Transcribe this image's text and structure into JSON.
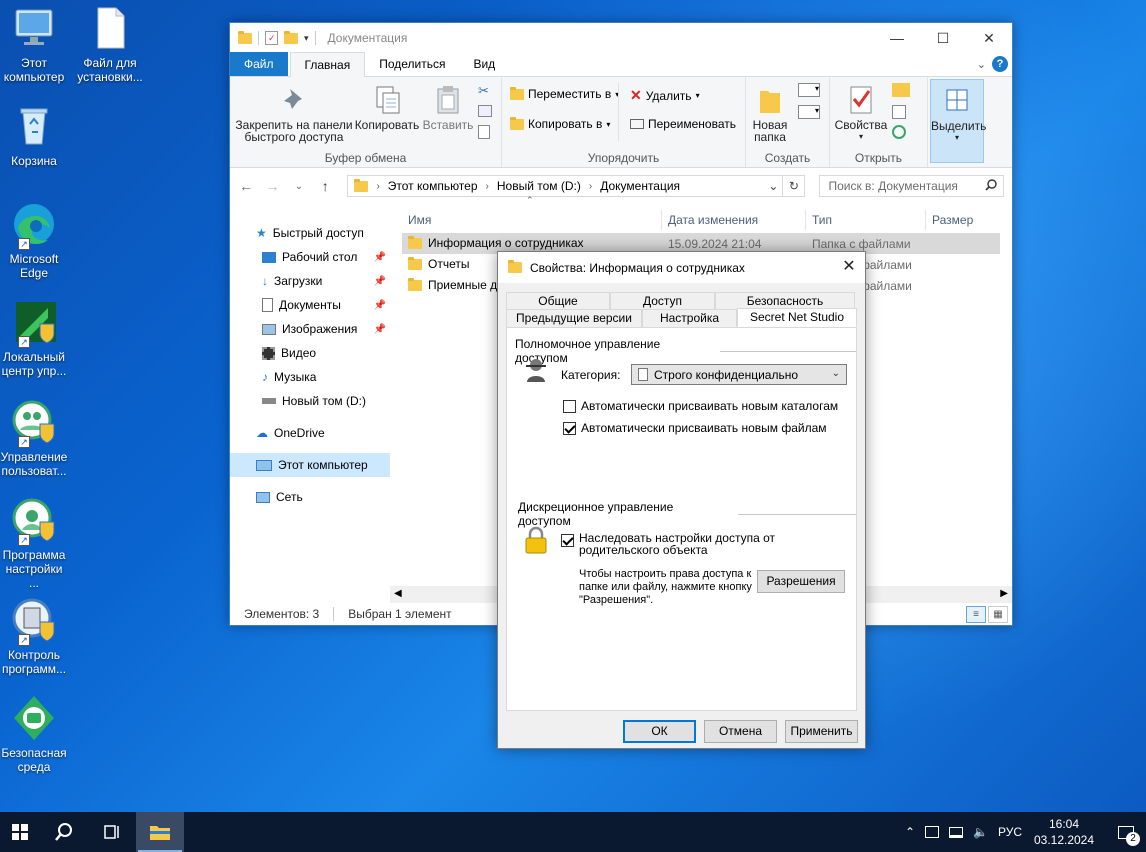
{
  "desktop": {
    "icons": [
      {
        "label": "Этот компьютер",
        "icon": "this-pc-icon"
      },
      {
        "label": "Файл для установки...",
        "icon": "file-icon"
      },
      {
        "label": "Корзина",
        "icon": "recycle-bin-icon"
      },
      {
        "label": "Microsoft Edge",
        "icon": "edge-icon"
      },
      {
        "label": "Локальный центр упр...",
        "icon": "local-control-center-icon"
      },
      {
        "label": "Управление пользоват...",
        "icon": "user-management-icon"
      },
      {
        "label": "Программа настройки ...",
        "icon": "setup-program-icon"
      },
      {
        "label": "Контроль программ...",
        "icon": "program-control-icon"
      },
      {
        "label": "Безопасная среда",
        "icon": "secure-environment-icon"
      }
    ]
  },
  "explorer": {
    "title": "Документация",
    "tabs": {
      "file": "Файл",
      "home": "Главная",
      "share": "Поделиться",
      "view": "Вид"
    },
    "ribbon": {
      "pin_label": "Закрепить на панели быстрого доступа",
      "copy_label": "Копировать",
      "paste_label": "Вставить",
      "clipboard_group": "Буфер обмена",
      "move_label": "Переместить в",
      "copyto_label": "Копировать в",
      "delete_label": "Удалить",
      "rename_label": "Переименовать",
      "organize_group": "Упорядочить",
      "newfolder_label": "Новая папка",
      "create_group": "Создать",
      "properties_label": "Свойства",
      "open_group": "Открыть",
      "select_label": "Выделить"
    },
    "address": {
      "crumbs": [
        "Этот компьютер",
        "Новый том (D:)",
        "Документация"
      ],
      "search_placeholder": "Поиск в: Документация"
    },
    "nav": {
      "quick_access": "Быстрый доступ",
      "desktop": "Рабочий стол",
      "downloads": "Загрузки",
      "documents": "Документы",
      "pictures": "Изображения",
      "video": "Видео",
      "music": "Музыка",
      "new_volume": "Новый том (D:)",
      "onedrive": "OneDrive",
      "this_pc": "Этот компьютер",
      "network": "Сеть"
    },
    "columns": {
      "name": "Имя",
      "date": "Дата изменения",
      "type": "Тип",
      "size": "Размер"
    },
    "files": [
      {
        "name": "Информация о сотрудниках",
        "date": "15.09.2024 21:04",
        "type": "Папка с файлами"
      },
      {
        "name": "Отчеты",
        "date": "",
        "type": "файлами"
      },
      {
        "name": "Приемные д",
        "date": "",
        "type": "файлами"
      }
    ],
    "status": {
      "count": "Элементов: 3",
      "selected": "Выбран 1 элемент"
    }
  },
  "dialog": {
    "title": "Свойства: Информация о сотрудниках",
    "tabs_row1": [
      "Общие",
      "Доступ",
      "Безопасность"
    ],
    "tabs_row2": [
      "Предыдущие версии",
      "Настройка",
      "Secret Net Studio"
    ],
    "mandatory_header": "Полномочное управление доступом",
    "category_label": "Категория:",
    "category_value": "Строго конфиденциально",
    "auto_catalogs": "Автоматически присваивать новым каталогам",
    "auto_files": "Автоматически присваивать новым файлам",
    "discretionary_header": "Дискреционное управление доступом",
    "inherit_label": "Наследовать настройки доступа от родительского объекта",
    "hint": "Чтобы настроить права доступа к папке или файлу, нажмите кнопку \"Разрешения\".",
    "permissions_button": "Разрешения",
    "ok": "ОК",
    "cancel": "Отмена",
    "apply": "Применить"
  },
  "taskbar": {
    "lang": "РУС",
    "time": "16:04",
    "date": "03.12.2024",
    "notif_count": "2"
  }
}
